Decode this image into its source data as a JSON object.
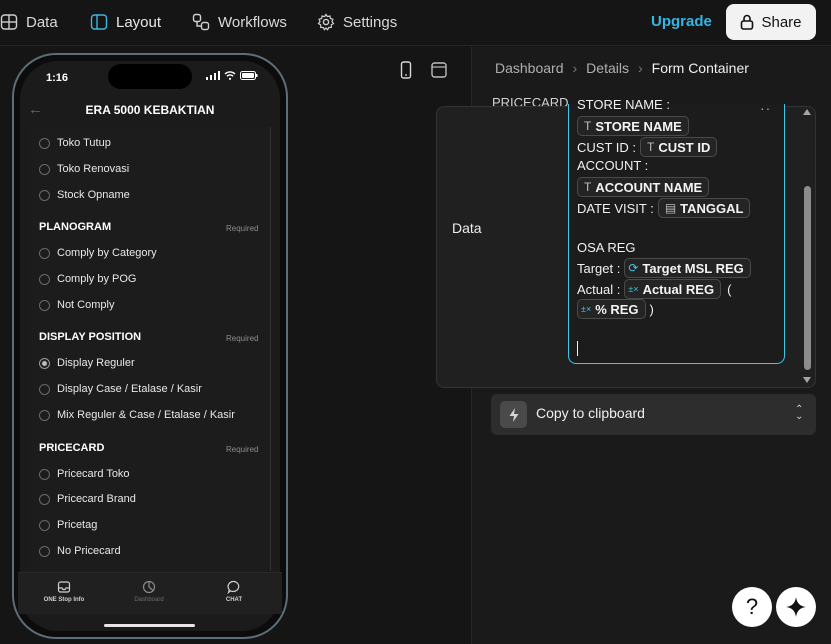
{
  "nav": {
    "items": [
      {
        "label": "Data",
        "icon": "grid-icon"
      },
      {
        "label": "Layout",
        "icon": "layout-icon"
      },
      {
        "label": "Workflows",
        "icon": "workflow-icon"
      },
      {
        "label": "Settings",
        "icon": "gear-icon"
      }
    ],
    "active": "Layout",
    "upgrade_label": "Upgrade",
    "share_label": "Share"
  },
  "phone": {
    "time": "1:16",
    "title": "ERA 5000 KEBAKTIAN",
    "top_options": [
      "Toko Tutup",
      "Toko Renovasi",
      "Stock Opname"
    ],
    "sections": [
      {
        "title": "PLANOGRAM",
        "required": "Required",
        "options": [
          "Comply by Category",
          "Comply by POG",
          "Not Comply"
        ],
        "selected": -1
      },
      {
        "title": "DISPLAY POSITION",
        "required": "Required",
        "options": [
          "Display Reguler",
          "Display Case / Etalase / Kasir",
          "Mix Reguler & Case / Etalase / Kasir"
        ],
        "selected": 0
      },
      {
        "title": "PRICECARD",
        "required": "Required",
        "options": [
          "Pricecard Toko",
          "Pricecard Brand",
          "Pricetag",
          "No Pricecard"
        ],
        "selected": -1
      }
    ],
    "tabs": [
      {
        "label": "ONE Stop Info",
        "icon": "inbox-icon",
        "active": true
      },
      {
        "label": "Dashboard",
        "icon": "chart-pie-icon",
        "active": false
      },
      {
        "label": "CHAT",
        "icon": "chat-bubble-icon",
        "active": true
      }
    ]
  },
  "breadcrumb": [
    "Dashboard",
    "Details",
    "Form Container"
  ],
  "panel": {
    "pricecard_label": "PRICECARD",
    "popup_label": "Data",
    "editor": {
      "store_name_label": "STORE NAME :",
      "store_name_chip": "STORE NAME",
      "cust_id_label": "CUST ID :",
      "cust_id_chip": "CUST ID",
      "account_label": "ACCOUNT :",
      "account_chip": "ACCOUNT NAME",
      "date_label": "DATE VISIT :",
      "date_chip": "TANGGAL",
      "osa_label": "OSA REG",
      "target_label": "Target :",
      "target_chip": "Target MSL REG",
      "actual_label": "Actual :",
      "actual_chip": "Actual REG",
      "open_paren": "(",
      "pct_chip": "% REG",
      "close_paren": ")"
    },
    "copy_label": "Copy to clipboard"
  },
  "fabs": {
    "help": "?",
    "ai": "sparkle-icon"
  },
  "colors": {
    "accent": "#35b5e3",
    "editor_border": "#3fc5e8",
    "background": "#141414"
  }
}
